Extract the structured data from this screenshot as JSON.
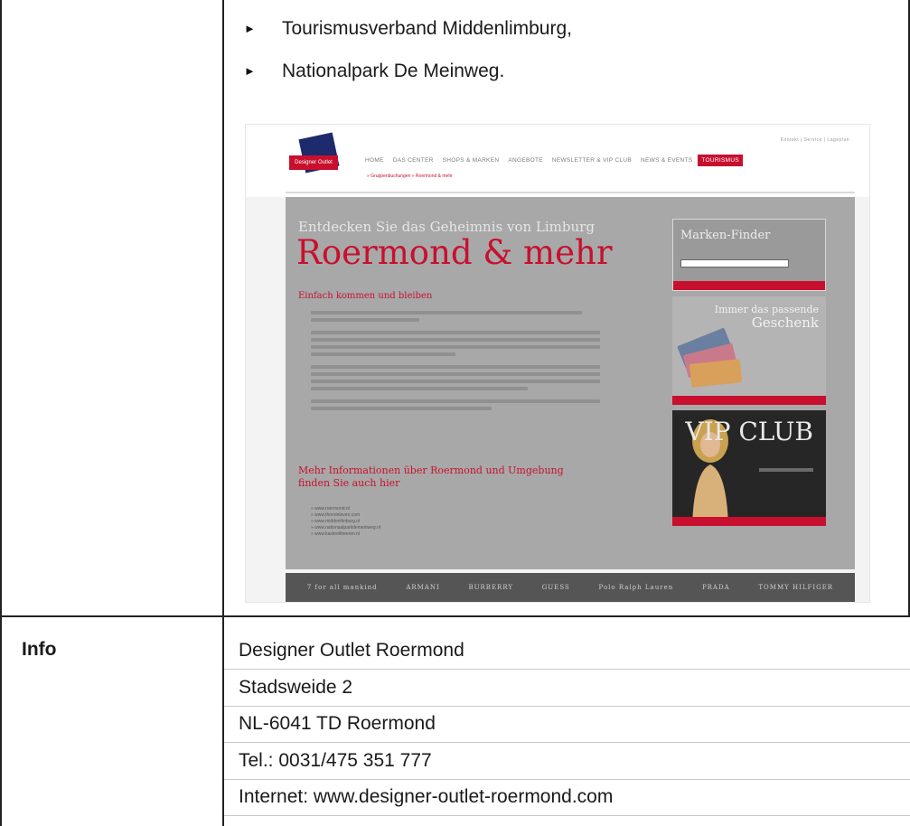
{
  "bullets": [
    {
      "label": "Tourismusverband Middenlimburg,"
    },
    {
      "label": "Nationalpark De Meinweg."
    }
  ],
  "info": {
    "label": "Info",
    "lines": [
      "Designer Outlet Roermond",
      "Stadsweide 2",
      "NL-6041 TD Roermond",
      "Tel.: 0031/475 351 777",
      "Internet: www.designer-outlet-roermond.com"
    ]
  },
  "embedded_site": {
    "logo_text": "Designer Outlet",
    "top_links": "Kontakt | Service | Lageplan",
    "nav": [
      "HOME",
      "DAS CENTER",
      "SHOPS & MARKEN",
      "ANGEBOTE",
      "NEWSLETTER & VIP CLUB",
      "NEWS & EVENTS",
      "TOURISMUS"
    ],
    "active_nav": "TOURISMUS",
    "subnav": "» Gruppenbuchungen   » Roermond & mehr",
    "kicker": "Entdecken Sie das Geheimnis von Limburg",
    "headline": "Roermond & mehr",
    "sub1": "Einfach kommen und bleiben",
    "sub2": "Mehr Informationen über Roermond und Umgebung finden Sie auch hier",
    "links": [
      "» www.roermond.nl",
      "» www.thorninleven.com",
      "» www.middenlimburg.nl",
      "» www.nationaalparkdemeinweg.nl",
      "» www.kasteeltheeren.nl"
    ],
    "finder_title": "Marken-Finder",
    "gift_line1": "Immer das passende",
    "gift_line2": "Geschenk",
    "vip_title": "VIP CLUB",
    "brands": [
      "7 for all mankind",
      "ARMANI",
      "BURBERRY",
      "GUESS",
      "Polo Ralph Lauren",
      "PRADA",
      "TOMMY HILFIGER"
    ]
  },
  "colors": {
    "brand_red": "#c8102e",
    "brand_blue": "#1d2a6b"
  }
}
